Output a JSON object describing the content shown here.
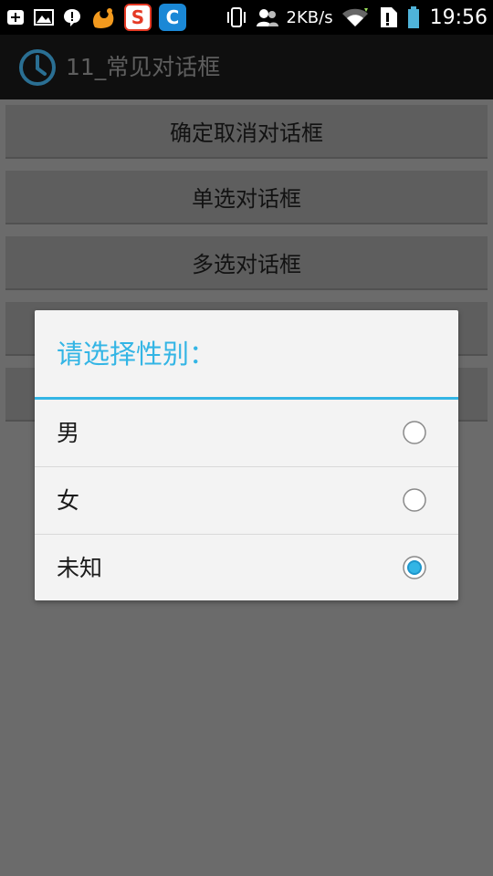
{
  "status_bar": {
    "network_speed": "2KB/s",
    "time": "19:56",
    "icons": [
      "add-icon",
      "image-icon",
      "alert-icon",
      "uc-browser-icon",
      "sogou-icon",
      "browser-icon",
      "vibrate-icon",
      "contacts-icon",
      "wifi-icon",
      "sim-icon",
      "battery-icon"
    ],
    "sogou_letter": "S",
    "browser_letter": "C"
  },
  "action_bar": {
    "title": "11_常见对话框",
    "icon": "clock-icon"
  },
  "buttons": [
    {
      "label": "确定取消对话框"
    },
    {
      "label": "单选对话框"
    },
    {
      "label": "多选对话框"
    }
  ],
  "dialog": {
    "title": "请选择性别：",
    "options": [
      {
        "label": "男",
        "checked": false
      },
      {
        "label": "女",
        "checked": false
      },
      {
        "label": "未知",
        "checked": true
      }
    ]
  },
  "colors": {
    "accent": "#33b5e5",
    "background_dim": "#6b6b6b",
    "dialog_bg": "#f3f3f3"
  }
}
